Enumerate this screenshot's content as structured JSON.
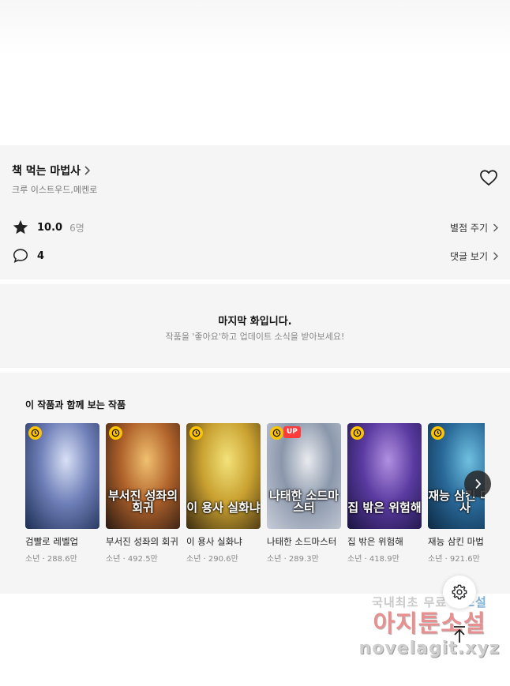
{
  "work": {
    "title": "책 먹는 마법사",
    "authors": "크루 이스트우드,메켄로",
    "rating": "10.0",
    "rating_count": "6명",
    "rate_action": "별점 주기",
    "comment_count": "4",
    "comment_action": "댓글 보기"
  },
  "last_episode": {
    "title": "마지막 화입니다.",
    "subtitle": "작품을 '좋아요'하고 업데이트 소식을 받아보세요!"
  },
  "recommendations": {
    "heading": "이 작품과 함께 보는 작품",
    "items": [
      {
        "title": "검빨로 레벨업",
        "meta": "소년 · 288.6만",
        "cover_text": "",
        "badge_up": false,
        "colors": [
          "#1c2d52",
          "#6f7fb8",
          "#d8e0f5"
        ]
      },
      {
        "title": "부서진 성좌의 회귀",
        "meta": "소년 · 492.5만",
        "cover_text": "부서진 성좌의 회귀",
        "badge_up": false,
        "colors": [
          "#2a1a12",
          "#b0622a",
          "#f0c070"
        ]
      },
      {
        "title": "이 용사 실화냐",
        "meta": "소년 · 290.6만",
        "cover_text": "이 용사 실화냐",
        "badge_up": false,
        "colors": [
          "#3a2a10",
          "#c8a030",
          "#f3e27a"
        ]
      },
      {
        "title": "나태한 소드마스터",
        "meta": "소년 · 289.3만",
        "cover_text": "나태한 소드마스터",
        "badge_up": true,
        "up_label": "UP",
        "colors": [
          "#c8cdd8",
          "#8a97ab",
          "#e9ebef"
        ]
      },
      {
        "title": "집 밖은 위험해",
        "meta": "소년 · 418.9만",
        "cover_text": "집 밖은 위험해",
        "badge_up": false,
        "colors": [
          "#1a1440",
          "#5a3aa0",
          "#b090e0"
        ]
      },
      {
        "title": "재능 삼킨 마법",
        "meta": "소년 · 921.6만",
        "cover_text": "재능 삼킨 마법사",
        "badge_up": false,
        "colors": [
          "#0d2a44",
          "#2a6a9a",
          "#6fc0e0"
        ]
      }
    ]
  },
  "watermark": {
    "line1_a": "국내최초 무료 ",
    "line1_b": "웹소설",
    "line2": "아지툰소설",
    "line3": "novelagit.xyz"
  },
  "colors": {
    "panel_bg": "#f5f5f5",
    "clock_badge": "#ffc400",
    "up_badge": "#ff3b3b"
  }
}
